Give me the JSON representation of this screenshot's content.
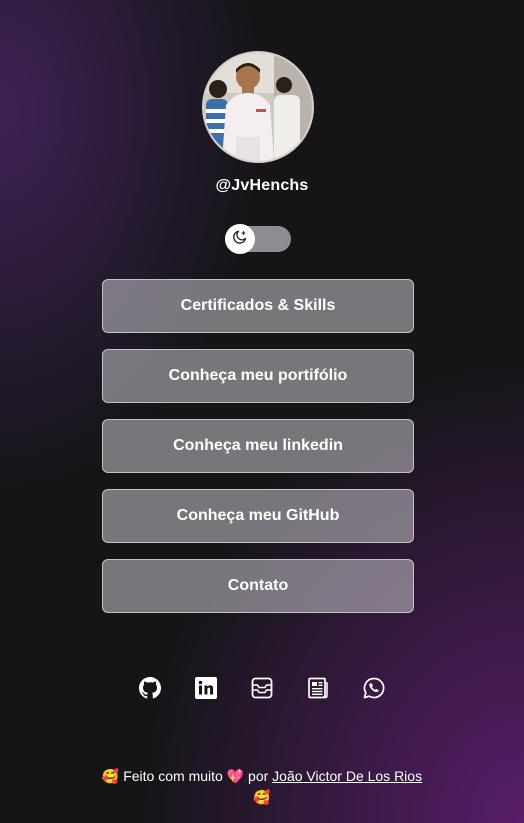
{
  "profile": {
    "username": "@JvHenchs",
    "avatar_alt": "profile photo"
  },
  "theme_toggle": {
    "icon": "moon-stars-icon",
    "state": "dark"
  },
  "links": [
    {
      "label": "Certificados & Skills"
    },
    {
      "label": "Conheça meu portifólio"
    },
    {
      "label": "Conheça meu linkedin"
    },
    {
      "label": "Conheça meu GitHub"
    },
    {
      "label": "Contato"
    }
  ],
  "socials": [
    {
      "icon": "github-icon"
    },
    {
      "icon": "linkedin-icon"
    },
    {
      "icon": "inbox-icon"
    },
    {
      "icon": "newspaper-icon"
    },
    {
      "icon": "whatsapp-icon"
    }
  ],
  "footer": {
    "emoji_start": "🥰",
    "text_before": "Feito com muito",
    "heart_emoji": "💖",
    "text_by": "por",
    "author": "João Victor De Los Rios",
    "emoji_end": "🥰"
  },
  "colors": {
    "background": "#151518",
    "accent_purple": "#5c1e6e",
    "button_bg": "#8e8c92",
    "toggle_track": "#8f8d91"
  }
}
